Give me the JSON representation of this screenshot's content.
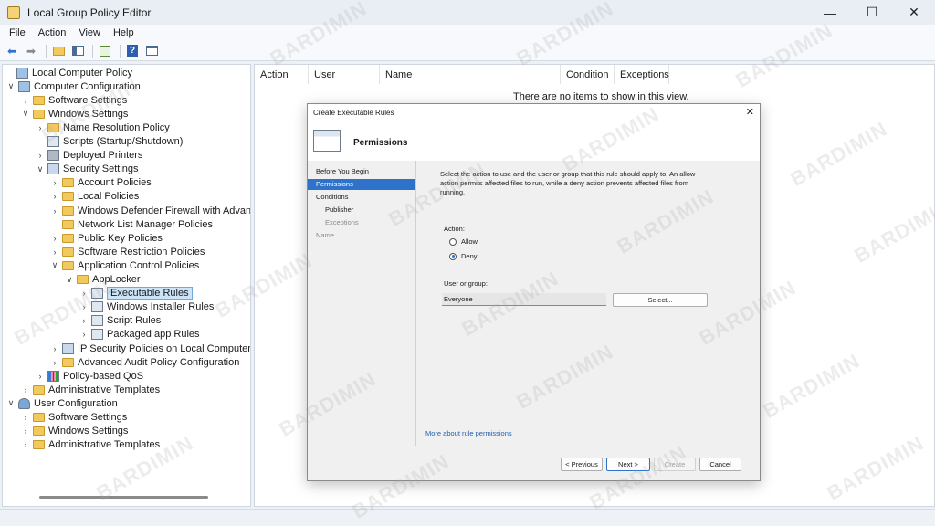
{
  "window": {
    "title": "Local Group Policy Editor",
    "min": "—",
    "max": "☐",
    "close": "✕"
  },
  "menu": [
    "File",
    "Action",
    "View",
    "Help"
  ],
  "tree": [
    {
      "label": "Local Computer Policy",
      "indent": 0,
      "chevron": "",
      "icon": "pc"
    },
    {
      "label": "Computer Configuration",
      "indent": 1,
      "chevron": "v",
      "icon": "pc"
    },
    {
      "label": "Software Settings",
      "indent": 2,
      "chevron": ">",
      "icon": "folder"
    },
    {
      "label": "Windows Settings",
      "indent": 2,
      "chevron": "v",
      "icon": "folder"
    },
    {
      "label": "Name Resolution Policy",
      "indent": 3,
      "chevron": ">",
      "icon": "folder"
    },
    {
      "label": "Scripts (Startup/Shutdown)",
      "indent": 3,
      "chevron": "",
      "icon": "doc"
    },
    {
      "label": "Deployed Printers",
      "indent": 3,
      "chevron": ">",
      "icon": "printer"
    },
    {
      "label": "Security Settings",
      "indent": 3,
      "chevron": "v",
      "icon": "shield"
    },
    {
      "label": "Account Policies",
      "indent": 4,
      "chevron": ">",
      "icon": "folder"
    },
    {
      "label": "Local Policies",
      "indent": 4,
      "chevron": ">",
      "icon": "folder"
    },
    {
      "label": "Windows Defender Firewall with Advance",
      "indent": 4,
      "chevron": ">",
      "icon": "folder"
    },
    {
      "label": "Network List Manager Policies",
      "indent": 4,
      "chevron": "",
      "icon": "folder"
    },
    {
      "label": "Public Key Policies",
      "indent": 4,
      "chevron": ">",
      "icon": "folder"
    },
    {
      "label": "Software Restriction Policies",
      "indent": 4,
      "chevron": ">",
      "icon": "folder"
    },
    {
      "label": "Application Control Policies",
      "indent": 4,
      "chevron": "v",
      "icon": "folder"
    },
    {
      "label": "AppLocker",
      "indent": 5,
      "chevron": "v",
      "icon": "folder"
    },
    {
      "label": "Executable Rules",
      "indent": 6,
      "chevron": ">",
      "icon": "doc",
      "selected": true
    },
    {
      "label": "Windows Installer Rules",
      "indent": 6,
      "chevron": ">",
      "icon": "doc"
    },
    {
      "label": "Script Rules",
      "indent": 6,
      "chevron": ">",
      "icon": "doc"
    },
    {
      "label": "Packaged app Rules",
      "indent": 6,
      "chevron": ">",
      "icon": "doc"
    },
    {
      "label": "IP Security Policies on Local Computer",
      "indent": 4,
      "chevron": ">",
      "icon": "shield"
    },
    {
      "label": "Advanced Audit Policy Configuration",
      "indent": 4,
      "chevron": ">",
      "icon": "folder"
    },
    {
      "label": "Policy-based QoS",
      "indent": 3,
      "chevron": ">",
      "icon": "bars"
    },
    {
      "label": "Administrative Templates",
      "indent": 2,
      "chevron": ">",
      "icon": "folder"
    },
    {
      "label": "User Configuration",
      "indent": 1,
      "chevron": "v",
      "icon": "user"
    },
    {
      "label": "Software Settings",
      "indent": 2,
      "chevron": ">",
      "icon": "folder"
    },
    {
      "label": "Windows Settings",
      "indent": 2,
      "chevron": ">",
      "icon": "folder"
    },
    {
      "label": "Administrative Templates",
      "indent": 2,
      "chevron": ">",
      "icon": "folder"
    }
  ],
  "list": {
    "columns": [
      "Action",
      "User",
      "Name",
      "Condition",
      "Exceptions"
    ],
    "empty": "There are no items to show in this view."
  },
  "dialog": {
    "title": "Create Executable Rules",
    "close": "✕",
    "header": "Permissions",
    "nav": [
      {
        "label": "Before You Begin",
        "state": "normal"
      },
      {
        "label": "Permissions",
        "state": "active"
      },
      {
        "label": "Conditions",
        "state": "normal"
      },
      {
        "label": "Publisher",
        "state": "sub"
      },
      {
        "label": "Exceptions",
        "state": "subdim"
      },
      {
        "label": "Name",
        "state": "dim"
      }
    ],
    "description": "Select the action to use and the user or group that this rule should apply to. An allow action permits affected files to run, while a deny action prevents affected files from running.",
    "action_label": "Action:",
    "allow": "Allow",
    "deny": "Deny",
    "selected_action": "Deny",
    "user_label": "User or group:",
    "user_value": "Everyone",
    "select_btn": "Select...",
    "more_link": "More about rule permissions",
    "prev_btn": "< Previous",
    "next_btn": "Next >",
    "create_btn": "Create",
    "cancel_btn": "Cancel"
  },
  "watermark": "BARDIMIN"
}
